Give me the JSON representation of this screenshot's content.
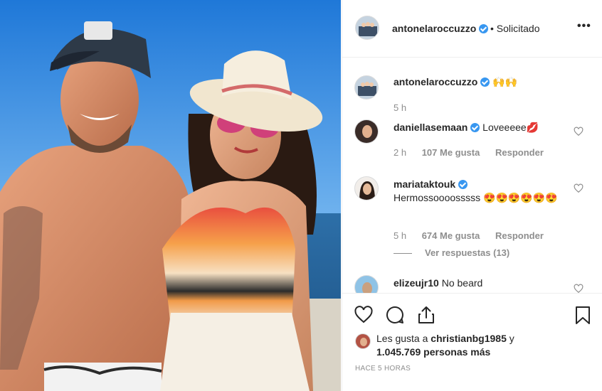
{
  "post": {
    "author": "antonelaroccuzzo",
    "follow_status": "• Solicitado",
    "more_label": "•••",
    "caption_emoji": "🙌🙌",
    "caption_time": "5 h"
  },
  "comments": [
    {
      "user": "daniellasemaan",
      "verified": true,
      "text": "Loveeeee💋",
      "time": "2 h",
      "likes": "107 Me gusta",
      "reply": "Responder"
    },
    {
      "user": "mariataktouk",
      "verified": true,
      "text": "Hermossoooosssss 😍😍😍😍😍😍",
      "time": "5 h",
      "likes": "674 Me gusta",
      "reply": "Responder",
      "view_replies": "Ver respuestas (13)"
    },
    {
      "user": "elizeujr10",
      "verified": false,
      "text": "No beard"
    }
  ],
  "footer": {
    "likes_prefix": "Les gusta a ",
    "likes_user": "christianbg1985",
    "likes_suffix": " y",
    "likes_count": "1.045.769 personas más",
    "time_ago": "HACE 5 HORAS"
  },
  "icons": [
    "heart-icon",
    "comment-icon",
    "share-icon",
    "bookmark-icon",
    "verified-icon",
    "more-icon"
  ],
  "colors": {
    "verified": "#3897f0",
    "muted": "#8e8e8e",
    "text": "#262626",
    "border": "#efefef"
  }
}
